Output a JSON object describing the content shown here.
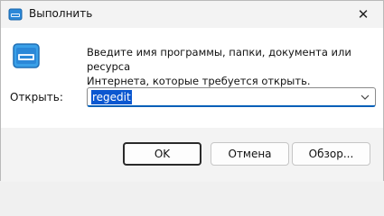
{
  "window": {
    "title": "Выполнить",
    "close_glyph": "✕"
  },
  "content": {
    "description_line1": "Введите имя программы, папки, документа или ресурса",
    "description_line2": "Интернета, которые требуется открыть.",
    "open_label": "Открыть:",
    "combo_value": "regedit",
    "combo_arrow_glyph": "⌄"
  },
  "buttons": {
    "ok": "OK",
    "cancel": "Отмена",
    "browse": "Обзор..."
  },
  "icons": {
    "app_icon": "run-dialog-icon",
    "big_icon": "run-window-icon",
    "close": "close-icon",
    "dropdown": "chevron-down-icon"
  },
  "colors": {
    "selection": "#0b57d0",
    "focus_underline": "#005fb8"
  }
}
